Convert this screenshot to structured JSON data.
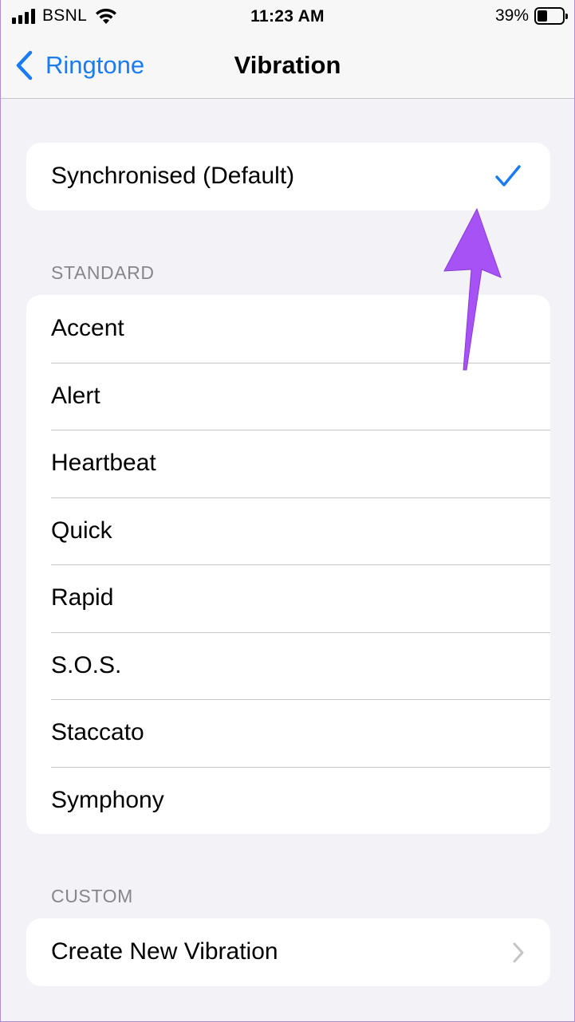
{
  "status_bar": {
    "carrier": "BSNL",
    "time": "11:23 AM",
    "battery_percent": "39%",
    "battery_level": 0.39,
    "icons": [
      "signal-icon",
      "wifi-icon",
      "battery-icon"
    ]
  },
  "nav": {
    "back_label": "Ringtone",
    "title": "Vibration",
    "accent_color": "#1a7cf5"
  },
  "default_option": {
    "label": "Synchronised (Default)",
    "selected": true
  },
  "standard": {
    "header": "STANDARD",
    "items": [
      {
        "label": "Accent"
      },
      {
        "label": "Alert"
      },
      {
        "label": "Heartbeat"
      },
      {
        "label": "Quick"
      },
      {
        "label": "Rapid"
      },
      {
        "label": "S.O.S."
      },
      {
        "label": "Staccato"
      },
      {
        "label": "Symphony"
      }
    ]
  },
  "custom": {
    "header": "CUSTOM",
    "create_label": "Create New Vibration"
  },
  "annotation": {
    "arrow_color": "#a652f5"
  }
}
